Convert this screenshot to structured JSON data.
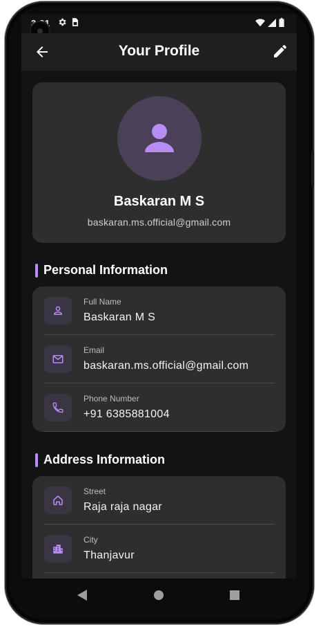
{
  "status_bar": {
    "time": "3:21"
  },
  "app_bar": {
    "title": "Your Profile"
  },
  "profile": {
    "name": "Baskaran M S",
    "email": "baskaran.ms.official@gmail.com"
  },
  "personal_section": {
    "title": "Personal Information",
    "items": [
      {
        "label": "Full Name",
        "value": "Baskaran M S",
        "icon": "person-icon"
      },
      {
        "label": "Email",
        "value": "baskaran.ms.official@gmail.com",
        "icon": "mail-icon"
      },
      {
        "label": "Phone Number",
        "value": "+91 6385881004",
        "icon": "phone-icon"
      }
    ]
  },
  "address_section": {
    "title": "Address Information",
    "items": [
      {
        "label": "Street",
        "value": "Raja raja nagar",
        "icon": "home-icon"
      },
      {
        "label": "City",
        "value": "Thanjavur",
        "icon": "city-icon"
      }
    ]
  },
  "colors": {
    "accent": "#b88cf5",
    "background": "#131313",
    "card": "#2e2e2e",
    "icon_box": "#3a3542",
    "avatar_bg": "#4a4159"
  }
}
